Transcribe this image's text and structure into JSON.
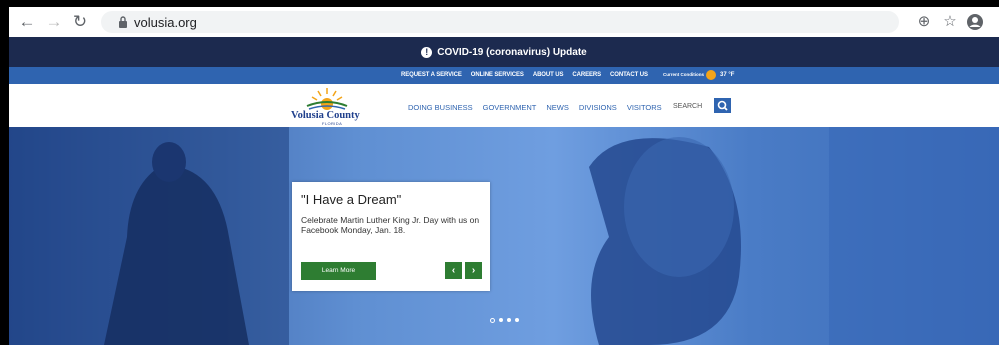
{
  "browser": {
    "url": "volusia.org"
  },
  "covid_banner": {
    "text": "COVID-19 (coronavirus) Update"
  },
  "utility_bar": {
    "links": [
      "REQUEST A SERVICE",
      "ONLINE SERVICES",
      "ABOUT US",
      "CAREERS",
      "CONTACT US"
    ],
    "conditions_label": "Current Conditions",
    "temperature": "37 °F"
  },
  "main_nav": {
    "logo_text": "Volusia County",
    "logo_sub": "FLORIDA",
    "links": [
      "DOING BUSINESS",
      "GOVERNMENT",
      "NEWS",
      "DIVISIONS",
      "VISITORS"
    ],
    "search_label": "SEARCH"
  },
  "hero": {
    "title": "\"I Have a Dream\"",
    "body": "Celebrate Martin Luther King Jr. Day with us on Facebook Monday, Jan. 18.",
    "button_label": "Learn More",
    "prev_label": "‹",
    "next_label": "›",
    "slide_count": 4,
    "active_slide": 1
  },
  "colors": {
    "banner": "#1c2a4f",
    "utility": "#2f64b0",
    "accent_green": "#2e7d32"
  }
}
